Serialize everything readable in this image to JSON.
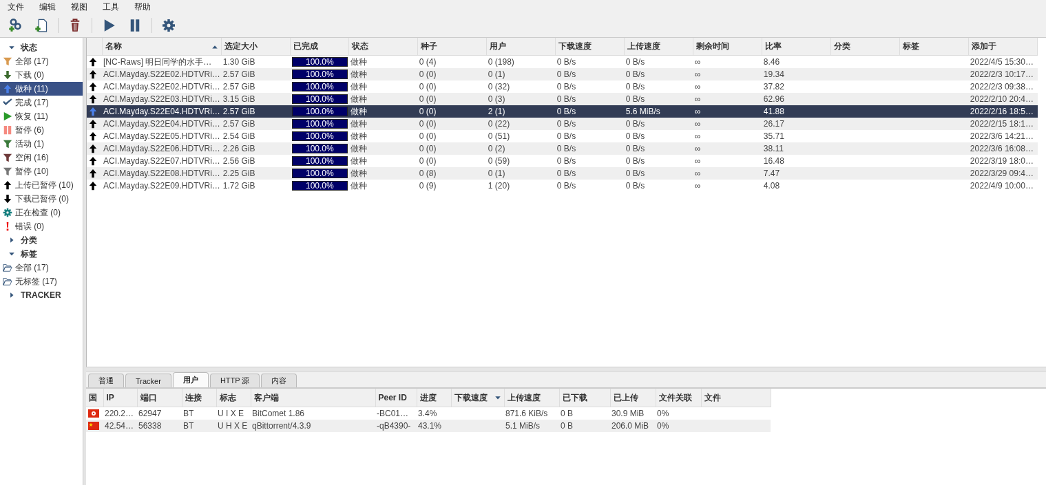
{
  "menu": [
    "文件",
    "编辑",
    "视图",
    "工具",
    "帮助"
  ],
  "toolbar": [
    {
      "kind": "add-link"
    },
    {
      "kind": "add-file"
    },
    {
      "kind": "sep"
    },
    {
      "kind": "delete"
    },
    {
      "kind": "sep"
    },
    {
      "kind": "play"
    },
    {
      "kind": "pause"
    },
    {
      "kind": "sep"
    },
    {
      "kind": "settings"
    }
  ],
  "sidebar": [
    {
      "title": "状态",
      "expanded": true,
      "items": [
        {
          "kind": "funnel-orange",
          "label": "全部 (17)",
          "selected": false
        },
        {
          "kind": "down-green",
          "label": "下载 (0)",
          "selected": false
        },
        {
          "kind": "up-blue",
          "label": "做种 (11)",
          "selected": true
        },
        {
          "kind": "check",
          "label": "完成 (17)",
          "selected": false
        },
        {
          "kind": "play",
          "label": "恢复 (11)",
          "selected": false
        },
        {
          "kind": "pause-red",
          "label": "暂停 (6)",
          "selected": false
        },
        {
          "kind": "funnel-green",
          "label": "活动 (1)",
          "selected": false
        },
        {
          "kind": "funnel-brown",
          "label": "空闲 (16)",
          "selected": false
        },
        {
          "kind": "funnel-grey",
          "label": "暂停 (10)",
          "selected": false
        },
        {
          "kind": "up-black",
          "label": "上传已暂停 (10)",
          "selected": false
        },
        {
          "kind": "down-black",
          "label": "下载已暂停 (0)",
          "selected": false
        },
        {
          "kind": "gear",
          "label": "正在检查 (0)",
          "selected": false
        },
        {
          "kind": "error",
          "label": "错误 (0)",
          "selected": false
        }
      ]
    },
    {
      "title": "分类",
      "expanded": false
    },
    {
      "title": "标签",
      "expanded": true,
      "items": [
        {
          "kind": "folder",
          "label": "全部 (17)",
          "selected": false
        },
        {
          "kind": "folder",
          "label": "无标签 (17)",
          "selected": false
        }
      ]
    },
    {
      "title": "TRACKER",
      "expanded": false
    }
  ],
  "torrents": {
    "columns": [
      {
        "label": "名称",
        "sort_ascending": true
      },
      {
        "label": "选定大小"
      },
      {
        "label": "已完成"
      },
      {
        "label": "状态"
      },
      {
        "label": "种子"
      },
      {
        "label": "用户"
      },
      {
        "label": "下载速度"
      },
      {
        "label": "上传速度"
      },
      {
        "label": "剩余时间"
      },
      {
        "label": "比率"
      },
      {
        "label": "分类"
      },
      {
        "label": "标签"
      },
      {
        "label": "添加于"
      }
    ],
    "rows": [
      {
        "selected": false,
        "name": "[NC-Raws] 明日同学的水手…",
        "size": "1.30 GiB",
        "level": 1,
        "progress": "100.0%",
        "status": "做种",
        "seeds": "0 (4)",
        "peers": "0 (198)",
        "down": "0 B/s",
        "up": "0 B/s",
        "eta": "∞",
        "ratio": "8.46",
        "added": "2022/4/5 15:30…"
      },
      {
        "selected": false,
        "name": "ACI.Mayday.S22E02.HDTVRi…",
        "size": "2.57 GiB",
        "level": 1,
        "progress": "100.0%",
        "status": "做种",
        "seeds": "0 (0)",
        "peers": "0 (1)",
        "down": "0 B/s",
        "up": "0 B/s",
        "eta": "∞",
        "ratio": "19.34",
        "added": "2022/2/3 10:17…"
      },
      {
        "selected": false,
        "name": "ACI.Mayday.S22E02.HDTVRi…",
        "size": "2.57 GiB",
        "level": 1,
        "progress": "100.0%",
        "status": "做种",
        "seeds": "0 (0)",
        "peers": "0 (32)",
        "down": "0 B/s",
        "up": "0 B/s",
        "eta": "∞",
        "ratio": "37.82",
        "added": "2022/2/3 09:38…"
      },
      {
        "selected": false,
        "name": "ACI.Mayday.S22E03.HDTVRi…",
        "size": "3.15 GiB",
        "level": 1,
        "progress": "100.0%",
        "status": "做种",
        "seeds": "0 (0)",
        "peers": "0 (3)",
        "down": "0 B/s",
        "up": "0 B/s",
        "eta": "∞",
        "ratio": "62.96",
        "added": "2022/2/10 20:4…"
      },
      {
        "selected": true,
        "name": "ACI.Mayday.S22E04.HDTVRi…",
        "size": "2.57 GiB",
        "level": 1,
        "progress": "100.0%",
        "status": "做种",
        "seeds": "0 (0)",
        "peers": "2 (1)",
        "down": "0 B/s",
        "up": "5.6 MiB/s",
        "eta": "∞",
        "ratio": "41.88",
        "added": "2022/2/16 18:5…"
      },
      {
        "selected": false,
        "name": "ACI.Mayday.S22E04.HDTVRi…",
        "size": "2.57 GiB",
        "level": 1,
        "progress": "100.0%",
        "status": "做种",
        "seeds": "0 (0)",
        "peers": "0 (22)",
        "down": "0 B/s",
        "up": "0 B/s",
        "eta": "∞",
        "ratio": "26.17",
        "added": "2022/2/15 18:1…"
      },
      {
        "selected": false,
        "name": "ACI.Mayday.S22E05.HDTVRi…",
        "size": "2.54 GiB",
        "level": 1,
        "progress": "100.0%",
        "status": "做种",
        "seeds": "0 (0)",
        "peers": "0 (51)",
        "down": "0 B/s",
        "up": "0 B/s",
        "eta": "∞",
        "ratio": "35.71",
        "added": "2022/3/6 14:21…"
      },
      {
        "selected": false,
        "name": "ACI.Mayday.S22E06.HDTVRi…",
        "size": "2.26 GiB",
        "level": 1,
        "progress": "100.0%",
        "status": "做种",
        "seeds": "0 (0)",
        "peers": "0 (2)",
        "down": "0 B/s",
        "up": "0 B/s",
        "eta": "∞",
        "ratio": "38.11",
        "added": "2022/3/6 16:08…"
      },
      {
        "selected": false,
        "name": "ACI.Mayday.S22E07.HDTVRi…",
        "size": "2.56 GiB",
        "level": 1,
        "progress": "100.0%",
        "status": "做种",
        "seeds": "0 (0)",
        "peers": "0 (59)",
        "down": "0 B/s",
        "up": "0 B/s",
        "eta": "∞",
        "ratio": "16.48",
        "added": "2022/3/19 18:0…"
      },
      {
        "selected": false,
        "name": "ACI.Mayday.S22E08.HDTVRi…",
        "size": "2.25 GiB",
        "level": 1,
        "progress": "100.0%",
        "status": "做种",
        "seeds": "0 (8)",
        "peers": "0 (1)",
        "down": "0 B/s",
        "up": "0 B/s",
        "eta": "∞",
        "ratio": "7.47",
        "added": "2022/3/29 09:4…"
      },
      {
        "selected": false,
        "name": "ACI.Mayday.S22E09.HDTVRi…",
        "size": "1.72 GiB",
        "level": 1,
        "progress": "100.0%",
        "status": "做种",
        "seeds": "0 (9)",
        "peers": "1 (20)",
        "down": "0 B/s",
        "up": "0 B/s",
        "eta": "∞",
        "ratio": "4.08",
        "added": "2022/4/9 10:00…"
      }
    ]
  },
  "tabs": [
    {
      "label": "普通",
      "selected": false
    },
    {
      "label": "Tracker",
      "selected": false
    },
    {
      "label": "用户",
      "selected": true
    },
    {
      "label": "HTTP 源",
      "selected": false
    },
    {
      "label": "内容",
      "selected": false
    }
  ],
  "peers": {
    "columns": [
      {
        "label": "国"
      },
      {
        "label": "IP"
      },
      {
        "label": "端口"
      },
      {
        "label": "连接"
      },
      {
        "label": "标志"
      },
      {
        "label": "客户端"
      },
      {
        "label": "Peer ID"
      },
      {
        "label": "进度"
      },
      {
        "label": "下载速度",
        "sort_descending": true
      },
      {
        "label": "上传速度"
      },
      {
        "label": "已下载"
      },
      {
        "label": "已上传"
      },
      {
        "label": "文件关联"
      },
      {
        "label": "文件"
      }
    ],
    "rows": [
      {
        "kind": "hk",
        "cells": [
          "",
          "220.2…",
          "62947",
          "BT",
          "U I X E",
          "BitComet 1.86",
          "-BC01…",
          "3.4%",
          "",
          "871.6 KiB/s",
          "0 B",
          "30.9 MiB",
          "0%",
          ""
        ]
      },
      {
        "kind": "cn",
        "cells": [
          "",
          "42.54…",
          "56338",
          "BT",
          "U H X E",
          "qBittorrent/4.3.9",
          "-qB4390-",
          "43.1%",
          "",
          "5.1 MiB/s",
          "0 B",
          "206.0 MiB",
          "0%",
          ""
        ]
      }
    ]
  }
}
